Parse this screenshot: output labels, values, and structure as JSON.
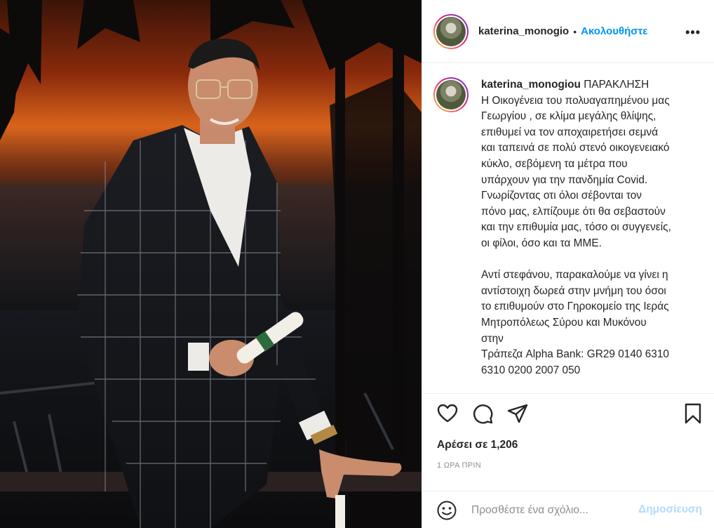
{
  "post": {
    "photo_alt": "photo",
    "author": {
      "username": "katerina_monogio",
      "follow_label": "Ακολουθήστε",
      "separator": "•",
      "more_label": "•••"
    },
    "caption": {
      "username": "katerina_monogiou",
      "text": " ΠΑΡΑΚΛΗΣΗ\nΗ Οικογένεια του πολυαγαπημένου μας\nΓεωργίου , σε κλίμα μεγάλης θλίψης,\nεπιθυμεί να τον αποχαιρετήσει σεμνά\nκαι ταπεινά σε πολύ στενό οικογενειακό\nκύκλο, σεβόμενη τα μέτρα που\nυπάρχουν για την πανδημία Covid.\nΓνωρίζοντας οτι όλοι σέβονται τον\nπόνο μας, ελπίζουμε ότι θα σεβαστούν\nκαι την επιθυμία μας, τόσο οι συγγενείς,\nοι φίλοι, όσο και τα ΜΜΕ.\n\nΑντί στεφάνου, παρακαλούμε να γίνει η\nαντίστοιχη δωρεά στην μνήμη του όσοι\nτο επιθυμούν στο Γηροκομείο της Ιεράς\nΜητροπόλεως Σύρου και Μυκόνου\nστην\nΤράπεζα Alpha Bank: GR29 0140 6310\n6310 0200 2007 050"
    },
    "actions": {
      "like_icon": "heart-icon",
      "comment_icon": "comment-icon",
      "share_icon": "paper-plane-icon",
      "save_icon": "bookmark-icon"
    },
    "likes_text": "Αρέσει σε 1,206",
    "time_text": "1 ΩΡΑ ΠΡΙΝ",
    "comment": {
      "placeholder": "Προσθέστε ένα σχόλιο...",
      "value": "",
      "post_label": "Δημοσίευση",
      "emoji_icon": "smiley-icon"
    }
  },
  "colors": {
    "link_blue": "#0095f6",
    "post_disabled": "#b3dbff",
    "text": "#262626",
    "muted": "#8e8e8e"
  }
}
